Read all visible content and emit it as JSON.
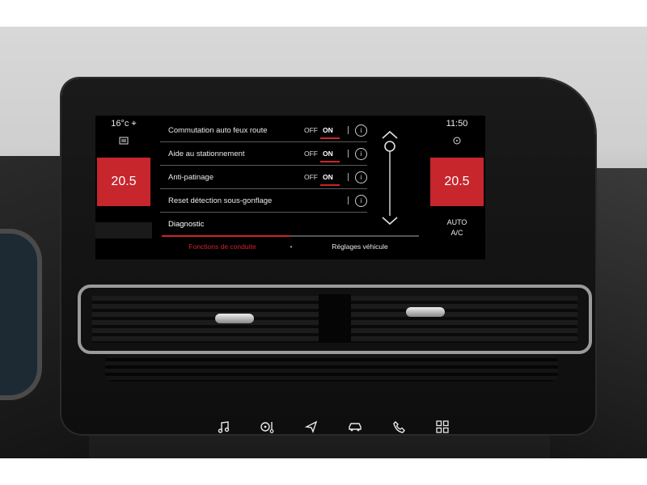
{
  "climate": {
    "left": {
      "outside_temp": "16°c",
      "temp": "20.5"
    },
    "right": {
      "clock": "11:50",
      "temp": "20.5",
      "mode": "AUTO",
      "ac": "A/C"
    }
  },
  "settings": [
    {
      "label": "Commutation auto feux route",
      "off": "OFF",
      "on": "ON",
      "state": "on"
    },
    {
      "label": "Aide au stationnement",
      "off": "OFF",
      "on": "ON",
      "state": "on"
    },
    {
      "label": "Anti-patinage",
      "off": "OFF",
      "on": "ON",
      "state": "on"
    }
  ],
  "reset": {
    "label": "Reset détection sous-gonflage"
  },
  "diagnostic": {
    "label": "Diagnostic"
  },
  "tabs": {
    "active": "Fonctions de conduite",
    "other": "Réglages véhicule",
    "dot": "•"
  },
  "page_progress": 0.5,
  "colors": {
    "accent": "#d0232a",
    "temp_box": "#c7262d",
    "screen_bg": "#000000"
  },
  "hard_keys": [
    "music-icon",
    "climate-icon",
    "navigation-icon",
    "car-icon",
    "phone-icon",
    "apps-grid-icon"
  ]
}
